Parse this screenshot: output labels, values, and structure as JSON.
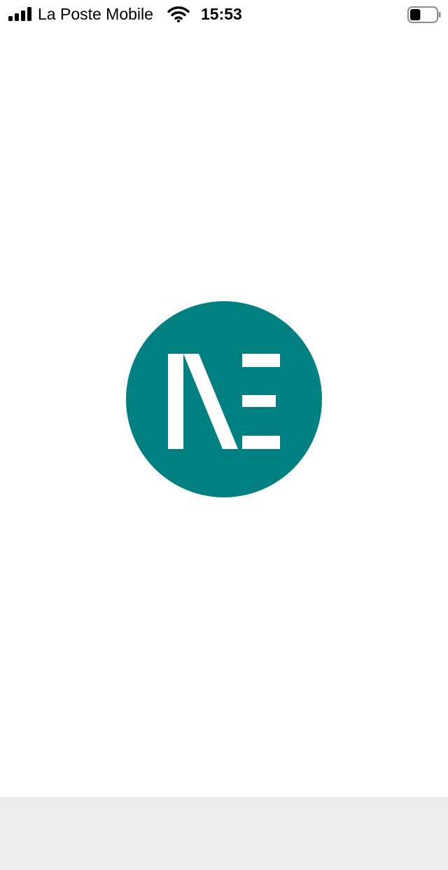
{
  "status_bar": {
    "carrier": "La Poste Mobile",
    "time": "15:53",
    "icons": {
      "signal": "cellular-signal-icon",
      "wifi": "wifi-icon",
      "battery": "battery-icon"
    },
    "battery_level": 0.4
  },
  "splash": {
    "logo_text": "NE",
    "logo_icon": "app-logo-icon",
    "colors": {
      "brand": "#008080",
      "background": "#ffffff",
      "bottom_panel": "#ededed"
    }
  }
}
